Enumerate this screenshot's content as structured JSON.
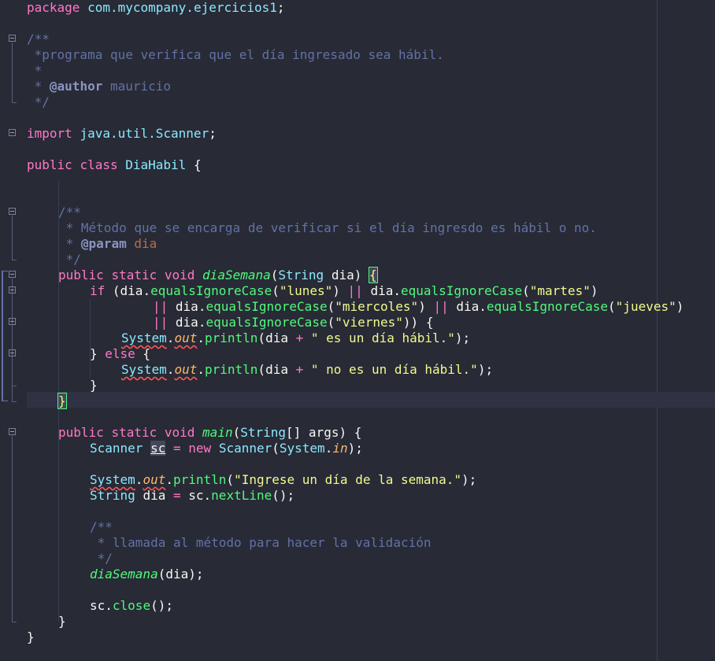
{
  "editor": {
    "language": "java",
    "theme_colors": {
      "background": "#282a36",
      "keyword": "#ff79c6",
      "type": "#8be9fd",
      "function": "#50fa7b",
      "string": "#f1fa8c",
      "comment": "#6272a4",
      "field": "#ffb86c"
    },
    "lines": {
      "l1": {
        "kw": "package",
        "pkg": "com.mycompany.ejercicios1",
        "end": ";"
      },
      "l3": "/**",
      "l4": " *programa que verifica que el día ingresado sea hábil.",
      "l5": " *",
      "l6_star": " * ",
      "l6_tag": "@author",
      "l6_val": " mauricio",
      "l7": " */",
      "l9": {
        "kw": "import",
        "pkg": "java.util.Scanner",
        "end": ";"
      },
      "l11": {
        "kw1": "public",
        "kw2": "class",
        "name": "DiaHabil",
        "end": " {"
      },
      "l14": "/**",
      "l15": " * Método que se encarga de verificar si el día ingresdo es hábil o no.",
      "l16_star": " * ",
      "l16_tag": "@param",
      "l16_val": " dia",
      "l17": " */",
      "l18": {
        "kw1": "public",
        "kw2": "static",
        "kw3": "void",
        "name": "diaSemana",
        "type": "String",
        "param": "dia",
        "brace": "{"
      },
      "l19": {
        "kw": "if",
        "var": "dia",
        "method": "equalsIgnoreCase",
        "s1": "\"lunes\"",
        "op": "||",
        "s2": "\"martes\""
      },
      "l20": {
        "op": "||",
        "var": "dia",
        "method": "equalsIgnoreCase",
        "s1": "\"miercoles\"",
        "s2": "\"jueves\""
      },
      "l21": {
        "op": "||",
        "var": "dia",
        "method": "equalsIgnoreCase",
        "s1": "\"viernes\""
      },
      "l22": {
        "cls": "System",
        "field": "out",
        "method": "println",
        "var": "dia",
        "op": "+",
        "str": "\" es un día hábil.\""
      },
      "l23": {
        "kw": "else"
      },
      "l24": {
        "cls": "System",
        "field": "out",
        "method": "println",
        "var": "dia",
        "op": "+",
        "str": "\" no es un día hábil.\""
      },
      "l25": "}",
      "l26": "}",
      "l28": {
        "kw1": "public",
        "kw2": "static",
        "kw3": "void",
        "name": "main",
        "type": "String",
        "param": "args"
      },
      "l29": {
        "type": "Scanner",
        "var": "sc",
        "kw": "new",
        "cls": "System",
        "field": "in"
      },
      "l31": {
        "cls": "System",
        "field": "out",
        "method": "println",
        "str": "\"Ingrese un día de la semana.\""
      },
      "l32": {
        "type": "String",
        "var": "dia",
        "obj": "sc",
        "method": "nextLine"
      },
      "l34": "/**",
      "l35": " * llamada al método para hacer la validación",
      "l36": " */",
      "l37": {
        "name": "diaSemana",
        "arg": "dia"
      },
      "l39": {
        "obj": "sc",
        "method": "close"
      },
      "l40": "}",
      "l41": "}"
    }
  }
}
